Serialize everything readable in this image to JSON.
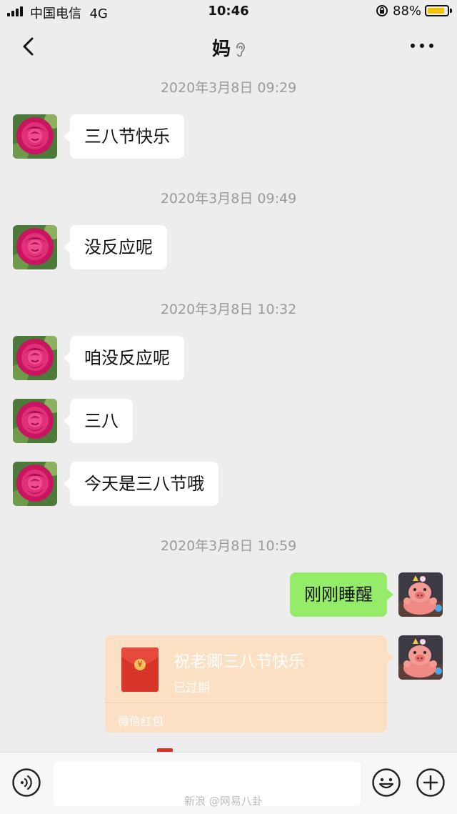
{
  "status_bar": {
    "carrier": "中国电信",
    "network": "4G",
    "time": "10:46",
    "battery_percent": "88%",
    "battery_level": 0.88,
    "battery_color": "#f5c400"
  },
  "nav": {
    "title": "妈",
    "back_icon": "chevron-left-icon",
    "ear_icon": "ear-icon",
    "more_icon": "more-dots-icon"
  },
  "messages": [
    {
      "type": "timestamp",
      "text": "2020年3月8日 09:29"
    },
    {
      "type": "received",
      "text": "三八节快乐"
    },
    {
      "type": "timestamp",
      "text": "2020年3月8日 09:49"
    },
    {
      "type": "received",
      "text": "没反应呢"
    },
    {
      "type": "timestamp",
      "text": "2020年3月8日 10:32"
    },
    {
      "type": "received",
      "text": "咱没反应呢"
    },
    {
      "type": "received",
      "text": "三八"
    },
    {
      "type": "received",
      "text": "今天是三八节哦"
    },
    {
      "type": "timestamp",
      "text": "2020年3月8日 10:59"
    },
    {
      "type": "sent",
      "text": "刚刚睡醒"
    },
    {
      "type": "red_packet",
      "title": "祝老卿三八节快乐",
      "status": "已过期",
      "footer": "微信红包"
    }
  ],
  "input_bar": {
    "voice_icon": "voice-icon",
    "emoji_icon": "emoji-icon",
    "plus_icon": "plus-icon"
  },
  "watermark": "新浪 @网易八卦",
  "colors": {
    "background": "#ededed",
    "sent_bubble": "#95ec69",
    "received_bubble": "#ffffff",
    "red_packet": "#fbe0c4",
    "envelope": "#d8352a"
  }
}
